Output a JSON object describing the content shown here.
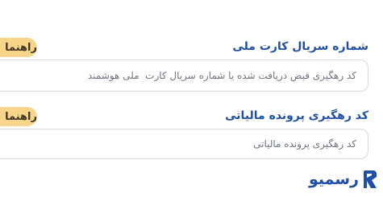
{
  "field1": {
    "label": "شماره سریال کارت ملی",
    "guide_label": "راهنما",
    "placeholder": "کد رهگیری قبض دریافت شده یا شماره سریال کارت  ملی هوشمند"
  },
  "field2": {
    "label": "کد رهگیری پرونده مالیاتی",
    "guide_label": "راهنما",
    "placeholder": "کد رهگیری پرونده مالیاتی"
  },
  "brand": {
    "name": "رسمیو"
  },
  "colors": {
    "accent_blue": "#1f4fa8",
    "guide_button": "#f7d58a",
    "input_border": "#d7dbe1"
  }
}
